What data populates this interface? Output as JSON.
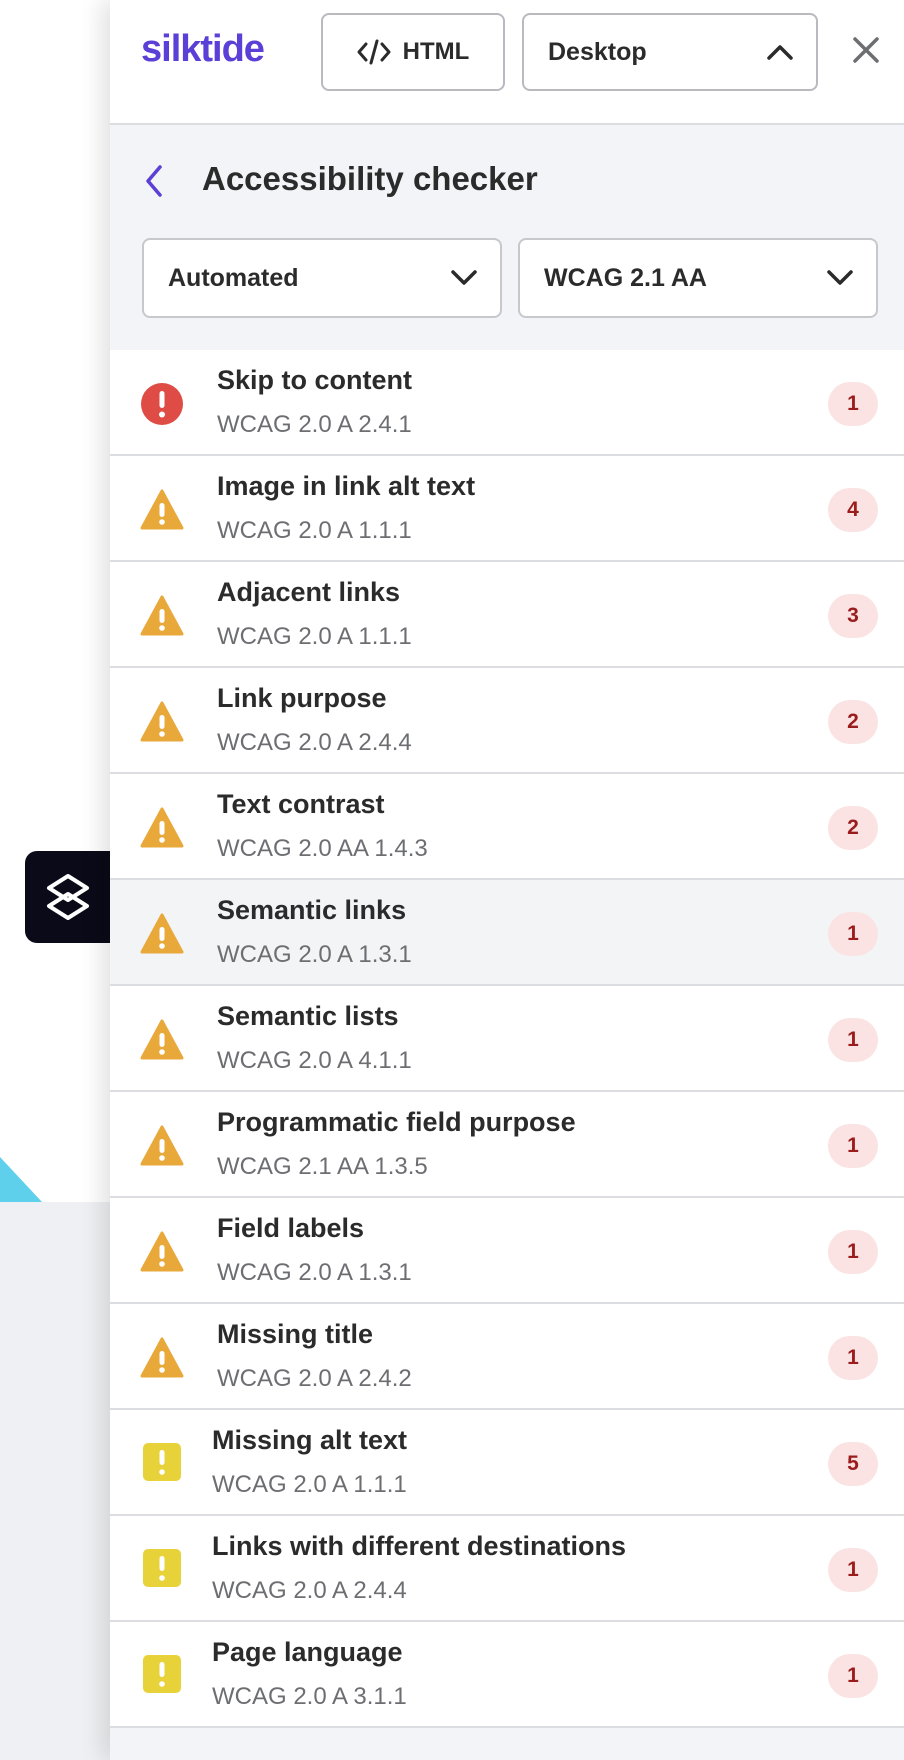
{
  "colors": {
    "brand": "#5b3fd6",
    "error": "#df4b45",
    "warning": "#e8a83a",
    "notice": "#e8d23a",
    "badge_bg": "#fbe3e3",
    "badge_text": "#9b1c1c"
  },
  "toolbar": {
    "logo": "silktide",
    "html_button": "HTML",
    "html_icon": "code-icon",
    "device": "Desktop",
    "close_icon": "close-icon"
  },
  "header": {
    "title": "Accessibility checker",
    "back_icon": "chevron-left-icon"
  },
  "filters": {
    "mode": "Automated",
    "standard": "WCAG 2.1 AA"
  },
  "issues": [
    {
      "title": "Skip to content",
      "criterion": "WCAG 2.0 A 2.4.1",
      "count": "1",
      "severity": "error"
    },
    {
      "title": "Image in link alt text",
      "criterion": "WCAG 2.0 A 1.1.1",
      "count": "4",
      "severity": "warning"
    },
    {
      "title": "Adjacent links",
      "criterion": "WCAG 2.0 A 1.1.1",
      "count": "3",
      "severity": "warning"
    },
    {
      "title": "Link purpose",
      "criterion": "WCAG 2.0 A 2.4.4",
      "count": "2",
      "severity": "warning"
    },
    {
      "title": "Text contrast",
      "criterion": "WCAG 2.0 AA 1.4.3",
      "count": "2",
      "severity": "warning"
    },
    {
      "title": "Semantic links",
      "criterion": "WCAG 2.0 A 1.3.1",
      "count": "1",
      "severity": "warning"
    },
    {
      "title": "Semantic lists",
      "criterion": "WCAG 2.0 A 4.1.1",
      "count": "1",
      "severity": "warning"
    },
    {
      "title": "Programmatic field purpose",
      "criterion": "WCAG 2.1 AA 1.3.5",
      "count": "1",
      "severity": "warning"
    },
    {
      "title": "Field labels",
      "criterion": "WCAG 2.0 A 1.3.1",
      "count": "1",
      "severity": "warning"
    },
    {
      "title": "Missing title",
      "criterion": "WCAG 2.0 A 2.4.2",
      "count": "1",
      "severity": "warning"
    },
    {
      "title": "Missing alt text",
      "criterion": "WCAG 2.0 A 1.1.1",
      "count": "5",
      "severity": "notice"
    },
    {
      "title": "Links with different destinations",
      "criterion": "WCAG 2.0 A 2.4.4",
      "count": "1",
      "severity": "notice"
    },
    {
      "title": "Page language",
      "criterion": "WCAG 2.0 A 3.1.1",
      "count": "1",
      "severity": "notice"
    }
  ]
}
